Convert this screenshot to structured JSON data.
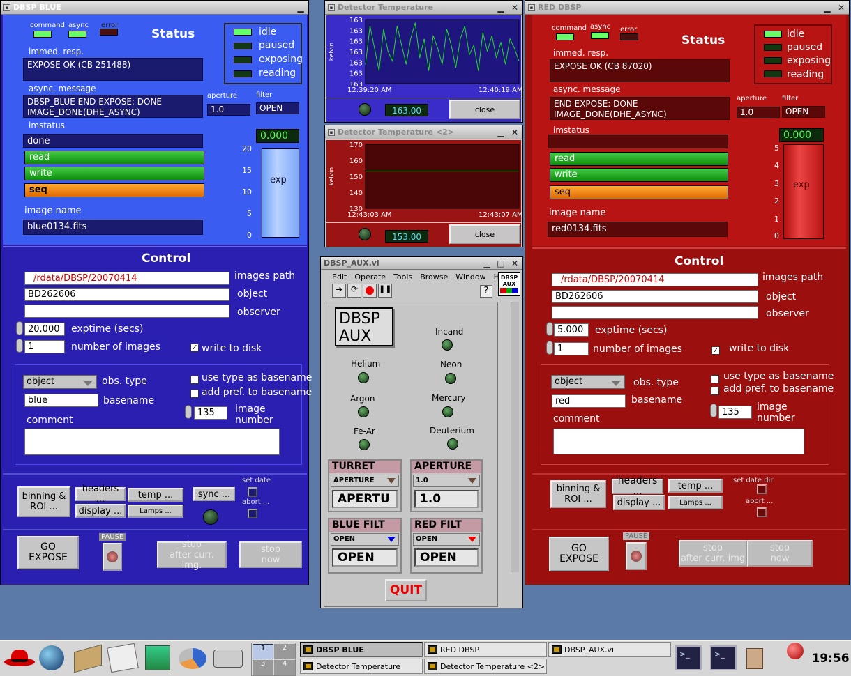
{
  "blue": {
    "title": "DBSP BLUE",
    "leds": {
      "command": "command",
      "async": "async",
      "error": "error"
    },
    "status": "Status",
    "states": [
      "idle",
      "paused",
      "exposing",
      "reading"
    ],
    "immed_label": "immed. resp.",
    "immed": "EXPOSE OK (CB 251488)",
    "async_label": "async. message",
    "async": "DBSP_BLUE END EXPOSE: DONE\nIMAGE_DONE(DHE_ASYNC)",
    "aperture_label": "aperture",
    "aperture": "1.0",
    "filter_label": "filter",
    "filter": "OPEN",
    "imstatus_label": "imstatus",
    "imstatus": "done",
    "read": "read",
    "write": "write",
    "seq": "seq",
    "image_name_label": "image name",
    "image_name": "blue0134.fits",
    "exp_value": "0.000",
    "exp_label": "exp",
    "scale": [
      "20",
      "15",
      "10",
      "5",
      "0"
    ],
    "control": "Control",
    "images_path": "/rdata/DBSP/20070414",
    "images_path_label": "images path",
    "object": "BD262606",
    "object_label": "object",
    "observer": "",
    "observer_label": "observer",
    "exptime": "20.000",
    "exptime_label": "exptime (secs)",
    "nimages": "1",
    "nimages_label": "number of images",
    "write_disk": "write to disk",
    "obstype": "object",
    "obstype_label": "obs. type",
    "basename": "blue",
    "basename_label": "basename",
    "use_type": "use type as basename",
    "add_pref": "add pref. to basename",
    "image_number": "135",
    "image_number_label": "image\nnumber",
    "comment_label": "comment",
    "binning": "binning &\nROI ...",
    "headers": "headers ...",
    "temp": "temp ...",
    "sync": "sync ...",
    "display": "display ...",
    "lamps": "Lamps ...",
    "set_date": "set date",
    "abort": "abort ...",
    "go": "GO\nEXPOSE",
    "pause": "PAUSE",
    "stop_after": "stop\nafter curr. img.",
    "stop_now": "stop\nnow"
  },
  "red": {
    "title": "RED DBSP",
    "leds": {
      "command": "command",
      "async": "async",
      "error": "error"
    },
    "status": "Status",
    "states": [
      "idle",
      "paused",
      "exposing",
      "reading"
    ],
    "immed_label": "immed. resp.",
    "immed": "EXPOSE OK (CB 87020)",
    "async_label": "async. message",
    "async": "END EXPOSE: DONE\nIMAGE_DONE(DHE_ASYNC)",
    "aperture_label": "aperture",
    "aperture": "1.0",
    "filter_label": "filter",
    "filter": "OPEN",
    "imstatus_label": "imstatus",
    "imstatus": "",
    "read": "read",
    "write": "write",
    "seq": "seq",
    "image_name_label": "image name",
    "image_name": "red0134.fits",
    "exp_value": "0.000",
    "exp_label": "exp",
    "scale": [
      "5",
      "4",
      "3",
      "2",
      "1",
      "0"
    ],
    "control": "Control",
    "images_path": "/rdata/DBSP/20070414",
    "images_path_label": "images path",
    "object": "BD262606",
    "object_label": "object",
    "observer": "",
    "observer_label": "observer",
    "exptime": "5.000",
    "exptime_label": "exptime (secs)",
    "nimages": "1",
    "nimages_label": "number of images",
    "write_disk": "write to disk",
    "obstype": "object",
    "obstype_label": "obs. type",
    "basename": "red",
    "basename_label": "basename",
    "use_type": "use type as basename",
    "add_pref": "add pref. to basename",
    "image_number": "135",
    "image_number_label": "image\nnumber",
    "comment_label": "comment",
    "binning": "binning &\nROI ...",
    "headers": "headers ...",
    "temp": "temp ...",
    "display": "display ...",
    "lamps": "Lamps ...",
    "set_date": "set date dir",
    "abort": "abort ...",
    "go": "GO\nEXPOSE",
    "pause": "PAUSE",
    "stop_after": "stop\nafter curr. img",
    "stop_now": "stop\nnow"
  },
  "temp1": {
    "title": "Detector Temperature",
    "ylabel": "kelvin",
    "ticks": [
      "163",
      "163",
      "163",
      "163",
      "163",
      "163",
      "163"
    ],
    "t0": "12:39:20 AM",
    "t1": "12:40:19 AM",
    "value": "163.00",
    "close": "close",
    "line_color": "#22dd22"
  },
  "temp2": {
    "title": "Detector Temperature <2>",
    "ylabel": "kelvin",
    "ticks": [
      "170",
      "160",
      "150",
      "140",
      "130"
    ],
    "t0": "12:43:03 AM",
    "t1": "12:43:07 AM",
    "value": "153.00",
    "close": "close",
    "line_color": "#22dd22"
  },
  "aux": {
    "title": "DBSP_AUX.vi",
    "menu": [
      "Edit",
      "Operate",
      "Tools",
      "Browse",
      "Window",
      "Help"
    ],
    "logo": "DBSP\nAUX",
    "lamps": [
      "Incand",
      "Helium",
      "Neon",
      "Argon",
      "Mercury",
      "Fe-Ar",
      "Deuterium"
    ],
    "turret": {
      "head": "TURRET",
      "sel": "APERTURE",
      "val": "APERTU"
    },
    "aperture": {
      "head": "APERTURE",
      "sel": "1.0",
      "val": "1.0"
    },
    "blue_filt": {
      "head": "BLUE FILT",
      "sel": "OPEN",
      "val": "OPEN"
    },
    "red_filt": {
      "head": "RED FILT",
      "sel": "OPEN",
      "val": "OPEN"
    },
    "quit": "QUIT"
  },
  "taskbar": {
    "desks": [
      "1",
      "2",
      "3",
      "4"
    ],
    "tasks": [
      "DBSP BLUE",
      "RED DBSP",
      "DBSP_AUX.vi",
      "Detector Temperature",
      "Detector Temperature <2>"
    ],
    "clock": "19:56"
  },
  "colors": {
    "blue": "#2a1fb0",
    "blue_top": "#3358f0",
    "red": "#9b0f0f",
    "red_top": "#b81414"
  }
}
